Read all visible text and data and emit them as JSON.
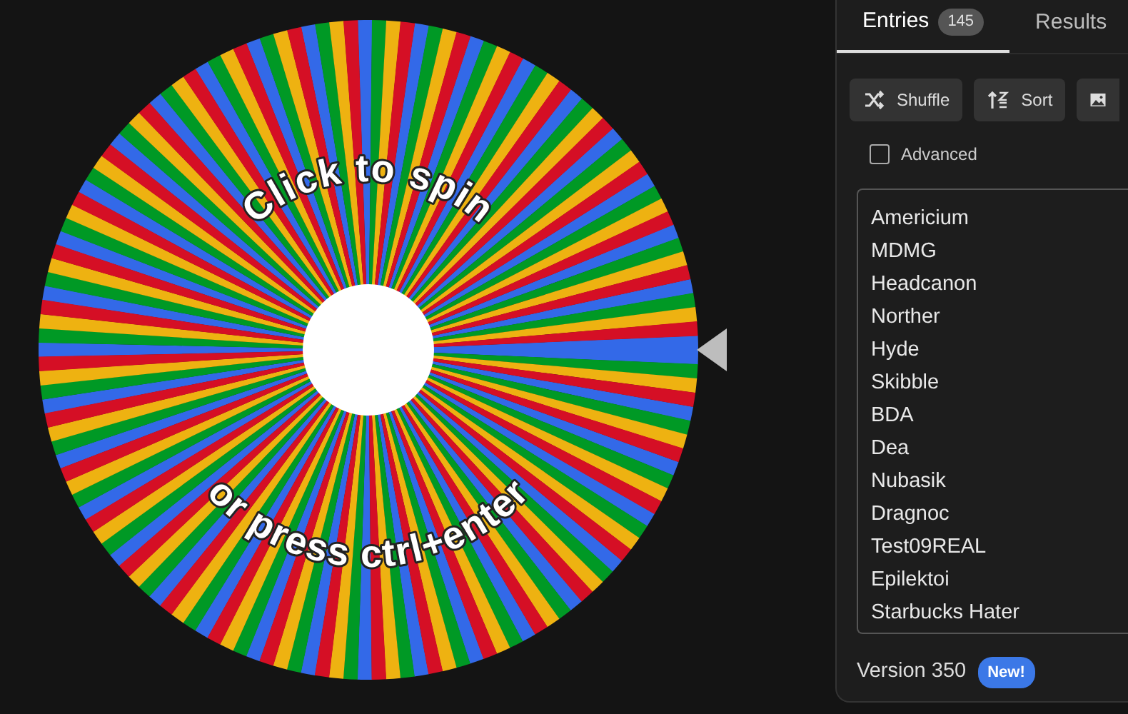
{
  "wheel": {
    "prompt_top": "Click to spin",
    "prompt_bottom": "or press ctrl+enter"
  },
  "tabs": [
    {
      "label": "Entries",
      "count": "145",
      "selected": true
    },
    {
      "label": "Results",
      "selected": false
    }
  ],
  "toolbar": [
    {
      "label": "Shuffle",
      "kind": "shuffle"
    },
    {
      "label": "Sort",
      "kind": "sort"
    },
    {
      "kind": "image"
    }
  ],
  "advanced": {
    "label": "Advanced",
    "checked": false
  },
  "entries": [
    "Americium",
    "MDMG",
    "Headcanon",
    "Norther",
    "Hyde",
    "Skibble",
    "BDA",
    "Dea",
    "Nubasik",
    "Dragnoc",
    "Test09REAL",
    "Epilektoi",
    "Starbucks Hater"
  ],
  "footer": {
    "version": "Version 350",
    "badge": "New!"
  }
}
